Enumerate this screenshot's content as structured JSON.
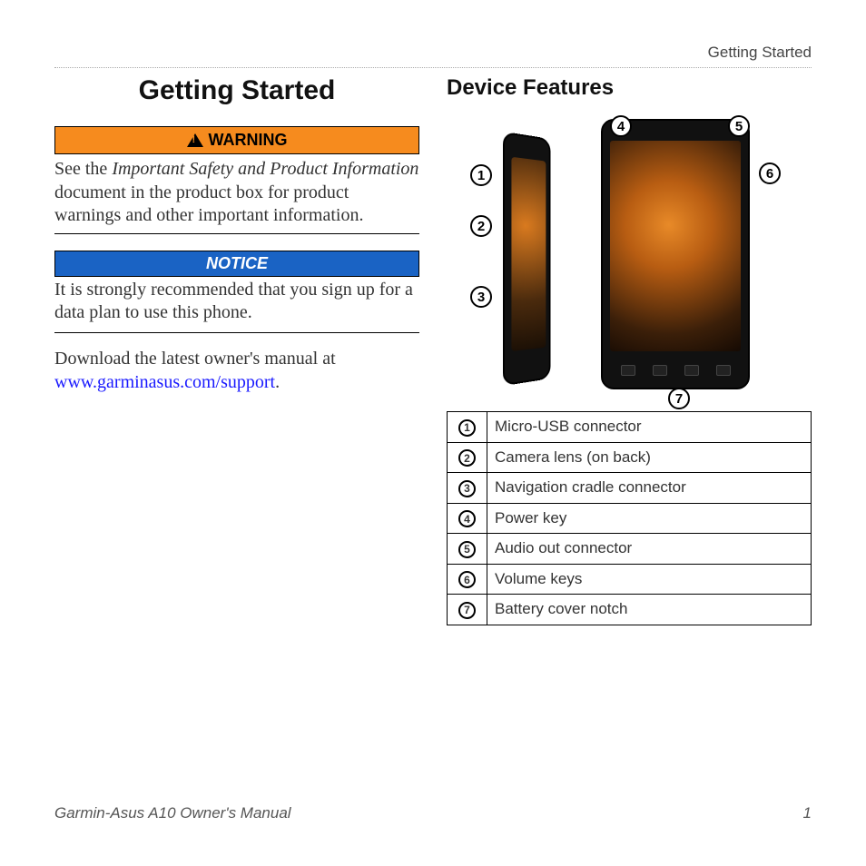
{
  "header": {
    "section": "Getting Started"
  },
  "left": {
    "title": "Getting Started",
    "warning_label": "WARNING",
    "warning_text_pre": "See the ",
    "warning_text_em": "Important Safety and Product Information",
    "warning_text_post": " document in the product box for product warnings and other important information.",
    "notice_label": "NOTICE",
    "notice_text": "It is strongly recommended that you sign up for a data plan to use this phone.",
    "download_pre": "Download the latest owner's manual at ",
    "download_link": "www.garminasus.com/support",
    "download_post": "."
  },
  "right": {
    "title": "Device Features",
    "callouts": {
      "c1": "1",
      "c2": "2",
      "c3": "3",
      "c4": "4",
      "c5": "5",
      "c6": "6",
      "c7": "7"
    },
    "features": [
      {
        "num": "1",
        "label": "Micro-USB connector"
      },
      {
        "num": "2",
        "label": "Camera lens (on back)"
      },
      {
        "num": "3",
        "label": "Navigation cradle connector"
      },
      {
        "num": "4",
        "label": "Power key"
      },
      {
        "num": "5",
        "label": "Audio out connector"
      },
      {
        "num": "6",
        "label": "Volume keys"
      },
      {
        "num": "7",
        "label": "Battery cover notch"
      }
    ]
  },
  "footer": {
    "manual": "Garmin-Asus A10 Owner's Manual",
    "page": "1"
  }
}
